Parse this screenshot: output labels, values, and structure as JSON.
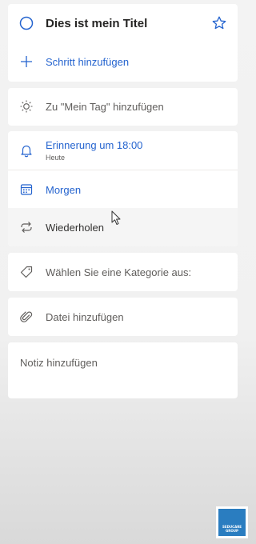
{
  "task": {
    "title": "Dies ist mein Titel",
    "add_step": "Schritt hinzufügen"
  },
  "my_day": {
    "label": "Zu \"Mein Tag\" hinzufügen"
  },
  "reminder": {
    "label": "Erinnerung um 18:00",
    "sub": "Heute"
  },
  "due": {
    "label": "Morgen"
  },
  "repeat": {
    "label": "Wiederholen"
  },
  "category": {
    "label": "Wählen Sie eine Kategorie aus:"
  },
  "file": {
    "label": "Datei hinzufügen"
  },
  "note": {
    "placeholder": "Notiz hinzufügen"
  },
  "logo": {
    "line1": "SEDUCARE",
    "line2": "GROUP"
  },
  "colors": {
    "accent": "#2564cf",
    "background": "#f3f3f3",
    "card": "#ffffff"
  }
}
